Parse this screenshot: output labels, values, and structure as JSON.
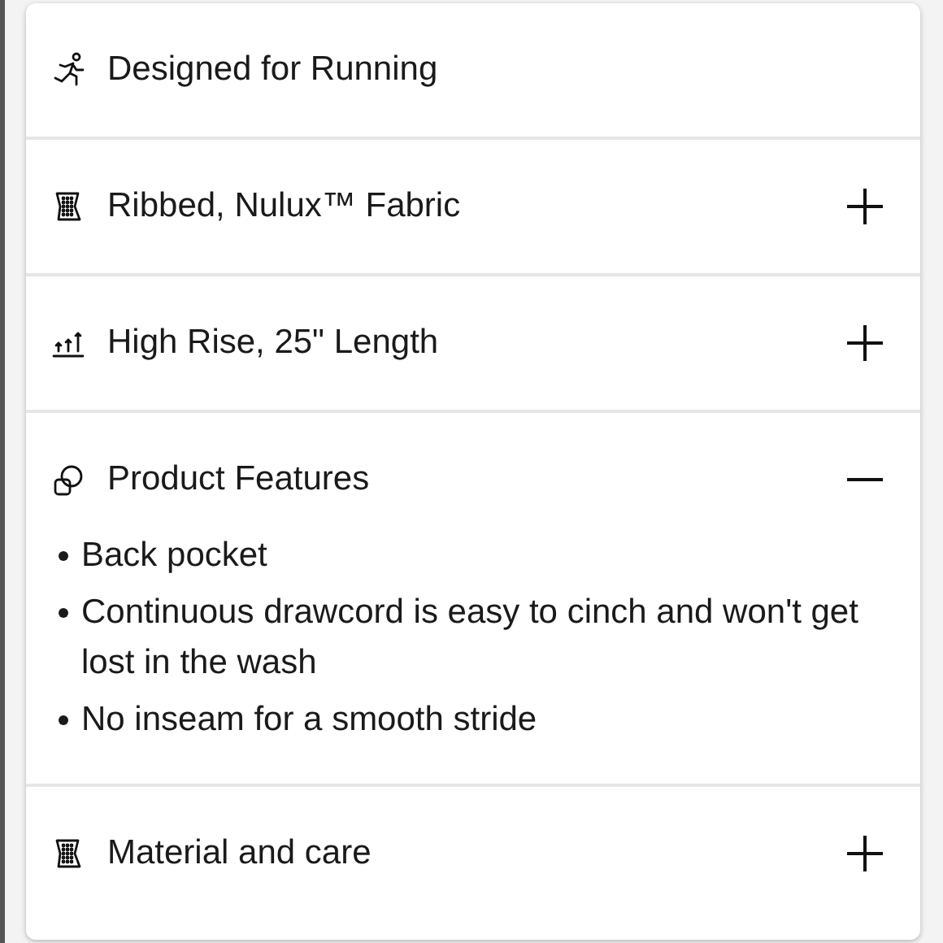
{
  "sections": [
    {
      "kind": "running",
      "title": "Designed for Running"
    },
    {
      "kind": "fabric",
      "title": "Ribbed, Nulux™ Fabric",
      "expanded": false
    },
    {
      "kind": "rise",
      "title": "High Rise, 25\" Length",
      "expanded": false
    },
    {
      "kind": "features",
      "title": "Product Features",
      "expanded": true,
      "bullets": [
        "Back pocket",
        "Continuous drawcord is easy to cinch and won't get lost in the wash",
        "No inseam for a smooth stride"
      ]
    },
    {
      "kind": "fabric",
      "title": "Material and care",
      "expanded": false
    }
  ]
}
